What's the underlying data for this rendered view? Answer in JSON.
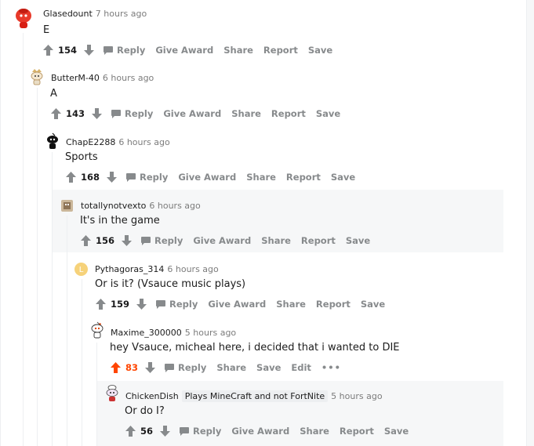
{
  "colors": {
    "upvote_active": "#ff4500",
    "meta_gray": "#878a8c",
    "highlight_bg": "#f6f7f8"
  },
  "labels": {
    "reply": "Reply",
    "give_award": "Give Award",
    "share": "Share",
    "report": "Report",
    "save": "Save",
    "edit": "Edit",
    "more": "•••"
  },
  "comments": [
    {
      "author": "Glasedount",
      "time": "7 hours ago",
      "text": "E",
      "score": "154",
      "avatar_icon": "red-snoo-avatar-icon"
    },
    {
      "author": "ButterM-40",
      "time": "6 hours ago",
      "text": "A",
      "score": "143",
      "avatar_icon": "crowned-snoo-avatar-icon"
    },
    {
      "author": "ChapE2288",
      "time": "6 hours ago",
      "text": "Sports",
      "score": "168",
      "avatar_icon": "black-snoo-avatar-icon"
    },
    {
      "author": "totallynotvexto",
      "time": "6 hours ago",
      "text": "It's in the game",
      "score": "156",
      "avatar_icon": "pixel-avatar-icon"
    },
    {
      "author": "Pythagoras_314",
      "time": "6 hours ago",
      "text": "Or is it? (Vsauce music plays)",
      "score": "159",
      "avatar_icon": "yellow-avatar-icon"
    },
    {
      "author": "Maxime_300000",
      "time": "5 hours ago",
      "text": "hey Vsauce, micheal here, i decided that i wanted to DIE",
      "score": "83",
      "avatar_icon": "snoo-avatar-icon"
    },
    {
      "author": "ChickenDish",
      "flair": "Plays MineCraft and not FortNite",
      "time": "5 hours ago",
      "text": "Or do I?",
      "score": "56",
      "avatar_icon": "chef-snoo-avatar-icon"
    }
  ]
}
